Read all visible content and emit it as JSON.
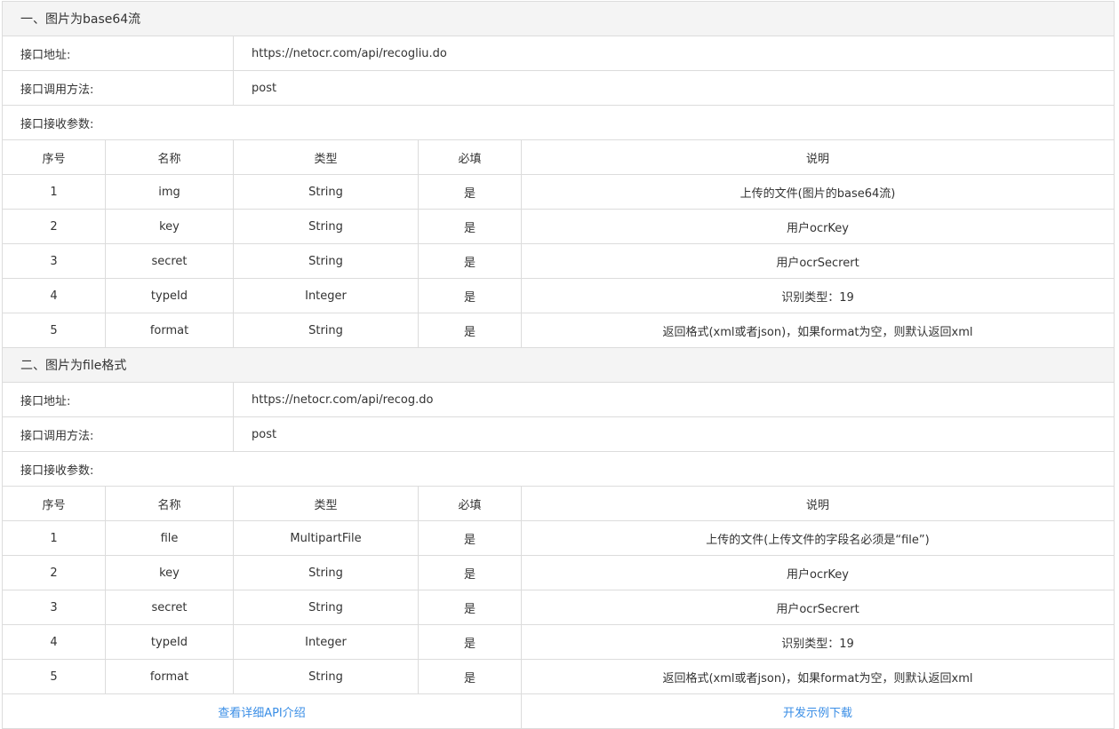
{
  "sections": [
    {
      "title": "一、图片为base64流",
      "address_label": "接口地址:",
      "address_value": "https://netocr.com/api/recogliu.do",
      "method_label": "接口调用方法:",
      "method_value": "post",
      "params_label": "接口接收参数:",
      "headers": [
        "序号",
        "名称",
        "类型",
        "必填",
        "说明"
      ],
      "rows": [
        [
          "1",
          "img",
          "String",
          "是",
          "上传的文件(图片的base64流)"
        ],
        [
          "2",
          "key",
          "String",
          "是",
          "用户ocrKey"
        ],
        [
          "3",
          "secret",
          "String",
          "是",
          "用户ocrSecrert"
        ],
        [
          "4",
          "typeId",
          "Integer",
          "是",
          "识别类型：19"
        ],
        [
          "5",
          "format",
          "String",
          "是",
          "返回格式(xml或者json)，如果format为空，则默认返回xml"
        ]
      ]
    },
    {
      "title": "二、图片为file格式",
      "address_label": "接口地址:",
      "address_value": "https://netocr.com/api/recog.do",
      "method_label": "接口调用方法:",
      "method_value": "post",
      "params_label": "接口接收参数:",
      "headers": [
        "序号",
        "名称",
        "类型",
        "必填",
        "说明"
      ],
      "rows": [
        [
          "1",
          "file",
          "MultipartFile",
          "是",
          "上传的文件(上传文件的字段名必须是“file”)"
        ],
        [
          "2",
          "key",
          "String",
          "是",
          "用户ocrKey"
        ],
        [
          "3",
          "secret",
          "String",
          "是",
          "用户ocrSecrert"
        ],
        [
          "4",
          "typeId",
          "Integer",
          "是",
          "识别类型：19"
        ],
        [
          "5",
          "format",
          "String",
          "是",
          "返回格式(xml或者json)，如果format为空，则默认返回xml"
        ]
      ]
    }
  ],
  "footer": {
    "api_link": "查看详细API介绍",
    "download_link": "开发示例下载",
    "link_color": "#3a8ee6"
  }
}
